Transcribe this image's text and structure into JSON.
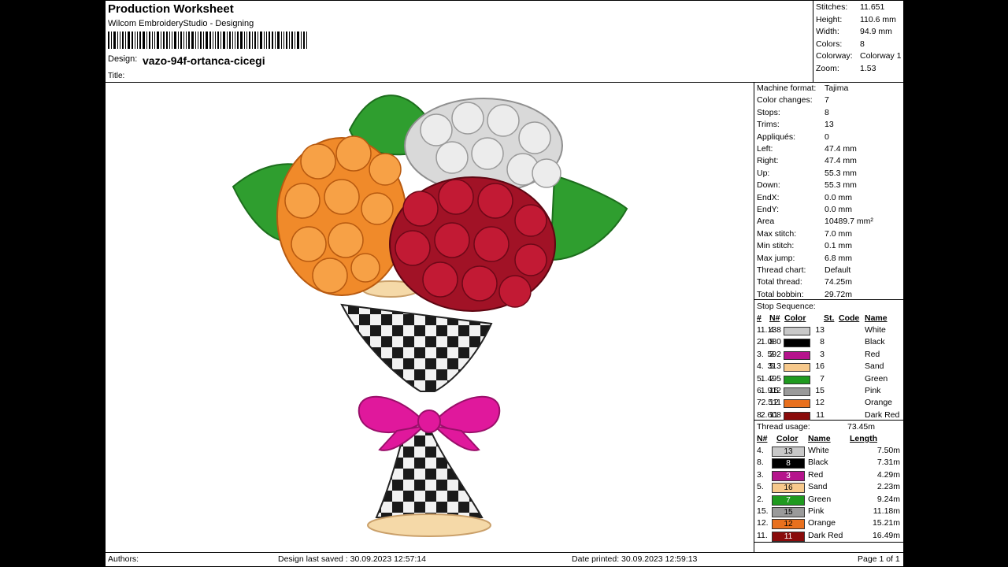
{
  "header": {
    "title": "Production Worksheet",
    "subtitle": "Wilcom EmbroideryStudio - Designing",
    "design_label": "Design:",
    "design_name": "vazo-94f-ortanca-cicegi",
    "title_label": "Title:"
  },
  "stats": [
    {
      "k": "Stitches:",
      "v": "11.651"
    },
    {
      "k": "Height:",
      "v": "110.6 mm"
    },
    {
      "k": "Width:",
      "v": "94.9 mm"
    },
    {
      "k": "Colors:",
      "v": "8"
    },
    {
      "k": "Colorway:",
      "v": "Colorway 1"
    },
    {
      "k": "Zoom:",
      "v": "1.53"
    }
  ],
  "info": [
    {
      "k": "Machine format:",
      "v": "Tajima"
    },
    {
      "k": "Color changes:",
      "v": "7"
    },
    {
      "k": "Stops:",
      "v": "8"
    },
    {
      "k": "Trims:",
      "v": "13"
    },
    {
      "k": "Appliqués:",
      "v": "0"
    },
    {
      "k": "Left:",
      "v": "47.4 mm"
    },
    {
      "k": "Right:",
      "v": "47.4 mm"
    },
    {
      "k": "Up:",
      "v": "55.3 mm"
    },
    {
      "k": "Down:",
      "v": "55.3 mm"
    },
    {
      "k": "EndX:",
      "v": "0.0 mm"
    },
    {
      "k": "EndY:",
      "v": "0.0 mm"
    },
    {
      "k": "Area",
      "v": "10489.7 mm²"
    },
    {
      "k": "Max stitch:",
      "v": "7.0 mm"
    },
    {
      "k": "Min stitch:",
      "v": "0.1 mm"
    },
    {
      "k": "Max jump:",
      "v": "6.8 mm"
    },
    {
      "k": "Thread chart:",
      "v": "Default"
    },
    {
      "k": "Total thread:",
      "v": "74.25m"
    },
    {
      "k": "Total bobbin:",
      "v": "29.72m"
    }
  ],
  "stop_sequence": {
    "caption": "Stop Sequence:",
    "headers": {
      "num": "#",
      "n": "N#",
      "color": "Color",
      "st": "St.",
      "code": "Code",
      "name": "Name"
    },
    "rows": [
      {
        "num": "1.",
        "n": "4",
        "color": "#c8c8c8",
        "st": "1.138",
        "code": "13",
        "name": "White"
      },
      {
        "num": "2.",
        "n": "8",
        "color": "#000000",
        "st": "1.080",
        "code": "8",
        "name": "Black"
      },
      {
        "num": "3.",
        "n": "3",
        "color": "#b5148c",
        "st": "592",
        "code": "3",
        "name": "Red"
      },
      {
        "num": "4.",
        "n": "5",
        "color": "#f7c98c",
        "st": "313",
        "code": "16",
        "name": "Sand"
      },
      {
        "num": "5.",
        "n": "2",
        "color": "#1f9a1f",
        "st": "1.495",
        "code": "7",
        "name": "Green"
      },
      {
        "num": "6.",
        "n": "15",
        "color": "#9a9a9a",
        "st": "1.912",
        "code": "15",
        "name": "Pink"
      },
      {
        "num": "7.",
        "n": "12",
        "color": "#e8701e",
        "st": "2.511",
        "code": "12",
        "name": "Orange"
      },
      {
        "num": "8.",
        "n": "11",
        "color": "#8a0b0b",
        "st": "2.608",
        "code": "11",
        "name": "Dark Red"
      }
    ]
  },
  "thread_usage": {
    "caption": "Thread usage:",
    "total": "73.45m",
    "headers": {
      "n": "N#",
      "color": "Color",
      "name": "Name",
      "length": "Length"
    },
    "rows": [
      {
        "n": "4.",
        "code": "13",
        "color": "#c8c8c8",
        "text": "#000000",
        "name": "White",
        "length": "7.50m"
      },
      {
        "n": "8.",
        "code": "8",
        "color": "#000000",
        "text": "#ffffff",
        "name": "Black",
        "length": "7.31m"
      },
      {
        "n": "3.",
        "code": "3",
        "color": "#b5148c",
        "text": "#ffffff",
        "name": "Red",
        "length": "4.29m"
      },
      {
        "n": "5.",
        "code": "16",
        "color": "#f7c98c",
        "text": "#000000",
        "name": "Sand",
        "length": "2.23m"
      },
      {
        "n": "2.",
        "code": "7",
        "color": "#1f9a1f",
        "text": "#ffffff",
        "name": "Green",
        "length": "9.24m"
      },
      {
        "n": "15.",
        "code": "15",
        "color": "#9a9a9a",
        "text": "#000000",
        "name": "Pink",
        "length": "11.18m"
      },
      {
        "n": "12.",
        "code": "12",
        "color": "#e8701e",
        "text": "#000000",
        "name": "Orange",
        "length": "15.21m"
      },
      {
        "n": "11.",
        "code": "11",
        "color": "#8a0b0b",
        "text": "#ffffff",
        "name": "Dark Red",
        "length": "16.49m"
      }
    ]
  },
  "footer": {
    "authors": "Authors:",
    "saved": "Design last saved : 30.09.2023 12:57:14",
    "printed": "Date printed: 30.09.2023 12:59:13",
    "page": "Page 1 of 1"
  }
}
